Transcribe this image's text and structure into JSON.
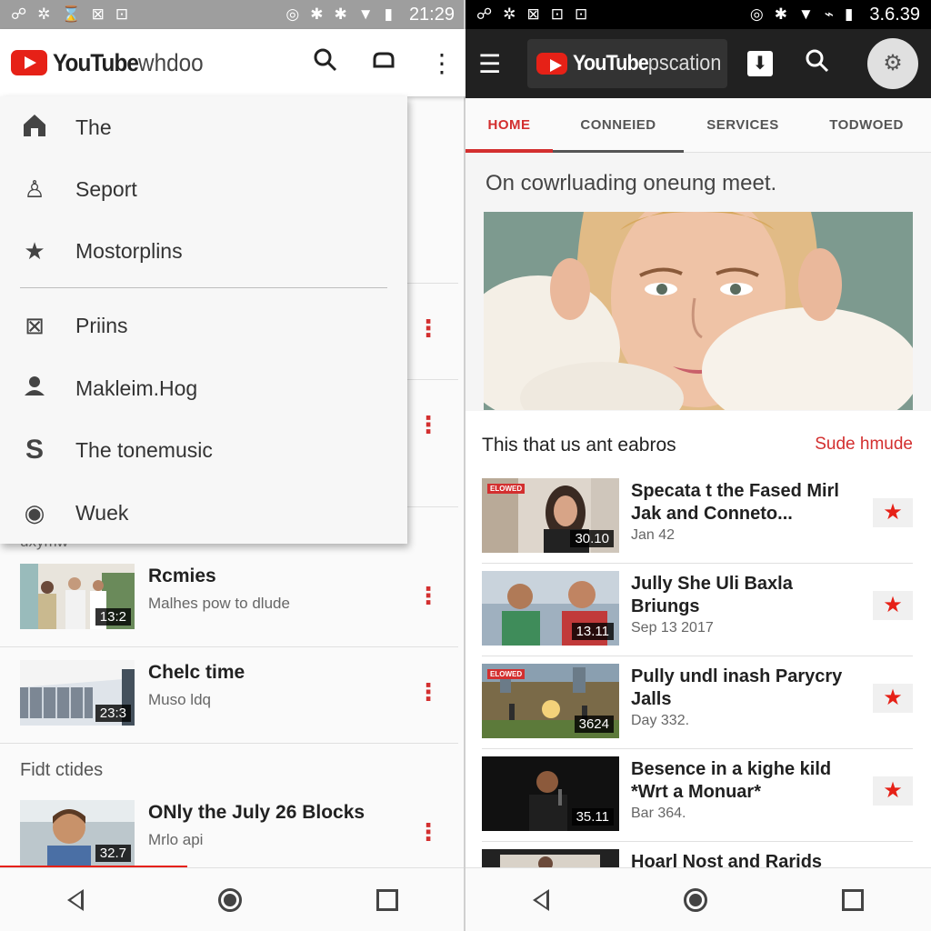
{
  "left": {
    "status": {
      "icons": [
        "☍",
        "✲",
        "⌛",
        "⊠",
        "⊡"
      ],
      "right_icons": [
        "◎",
        "✱",
        "✱",
        "▼",
        "▮"
      ],
      "time": "21:29"
    },
    "appbar": {
      "brand_bold": "YouTube",
      "brand_light": "whdoo",
      "icons": [
        "search-icon",
        "cast-icon",
        "more-icon"
      ]
    },
    "drawer": {
      "items": [
        {
          "icon": "⌂",
          "label": "The"
        },
        {
          "icon": "♙",
          "label": "Seport"
        },
        {
          "icon": "★",
          "label": "Mostorplins"
        },
        {
          "icon": "⊠",
          "label": "Priins"
        },
        {
          "icon": "●",
          "label": "Makleim.Hog"
        },
        {
          "icon": "S",
          "label": "The tonemusic"
        },
        {
          "icon": "◉",
          "label": "Wuek"
        }
      ]
    },
    "peek_text": "uxymw",
    "videos": [
      {
        "title": "Rcmies",
        "sub": "Malhes pow to dlude",
        "duration": "13:2"
      },
      {
        "title": "Chelc time",
        "sub": "Muso ldq",
        "duration": "23:3"
      }
    ],
    "section_title": "Fidt ctides",
    "featured": {
      "title": "ONly the July 26 Blocks",
      "sub": "Mrlo api",
      "duration": "32.7"
    }
  },
  "right": {
    "status": {
      "icons": [
        "☍",
        "✲",
        "⊠",
        "⊡",
        "⊡"
      ],
      "right_icons": [
        "◎",
        "✱",
        "▼",
        "⌁",
        "▮"
      ],
      "time": "3.6.39"
    },
    "appbar": {
      "brand_bold": "YouTube",
      "brand_light": "pscation",
      "avatar": "⚙"
    },
    "tabs": [
      "HOME",
      "CONNEIED",
      "SERVICES",
      "TODWOED"
    ],
    "headline": "On cowrluading oneung meet.",
    "list_title": "This that us ant eabros",
    "list_link": "Sude hmude",
    "videos": [
      {
        "title": "Specata t the Fased Mirl Jak and Conneto...",
        "sub": "Jan 42",
        "duration": "30.10",
        "tag": "ELOWED"
      },
      {
        "title": "Jully She Uli Baxla Briungs",
        "sub": "Sep 13 2017",
        "duration": "13.11",
        "tag": ""
      },
      {
        "title": "Pully undl inash Parycry Jalls",
        "sub": "Day 332.",
        "duration": "3624",
        "tag": "ELOWED"
      },
      {
        "title": "Besence in a kighe kild *Wrt a Monuar*",
        "sub": "Bar 364.",
        "duration": "35.11",
        "tag": ""
      },
      {
        "title": "Hoarl Nost and Rarids",
        "sub": "",
        "duration": "",
        "tag": ""
      }
    ]
  },
  "colors": {
    "brand_red": "#e62117",
    "accent_red": "#d32f2f"
  }
}
